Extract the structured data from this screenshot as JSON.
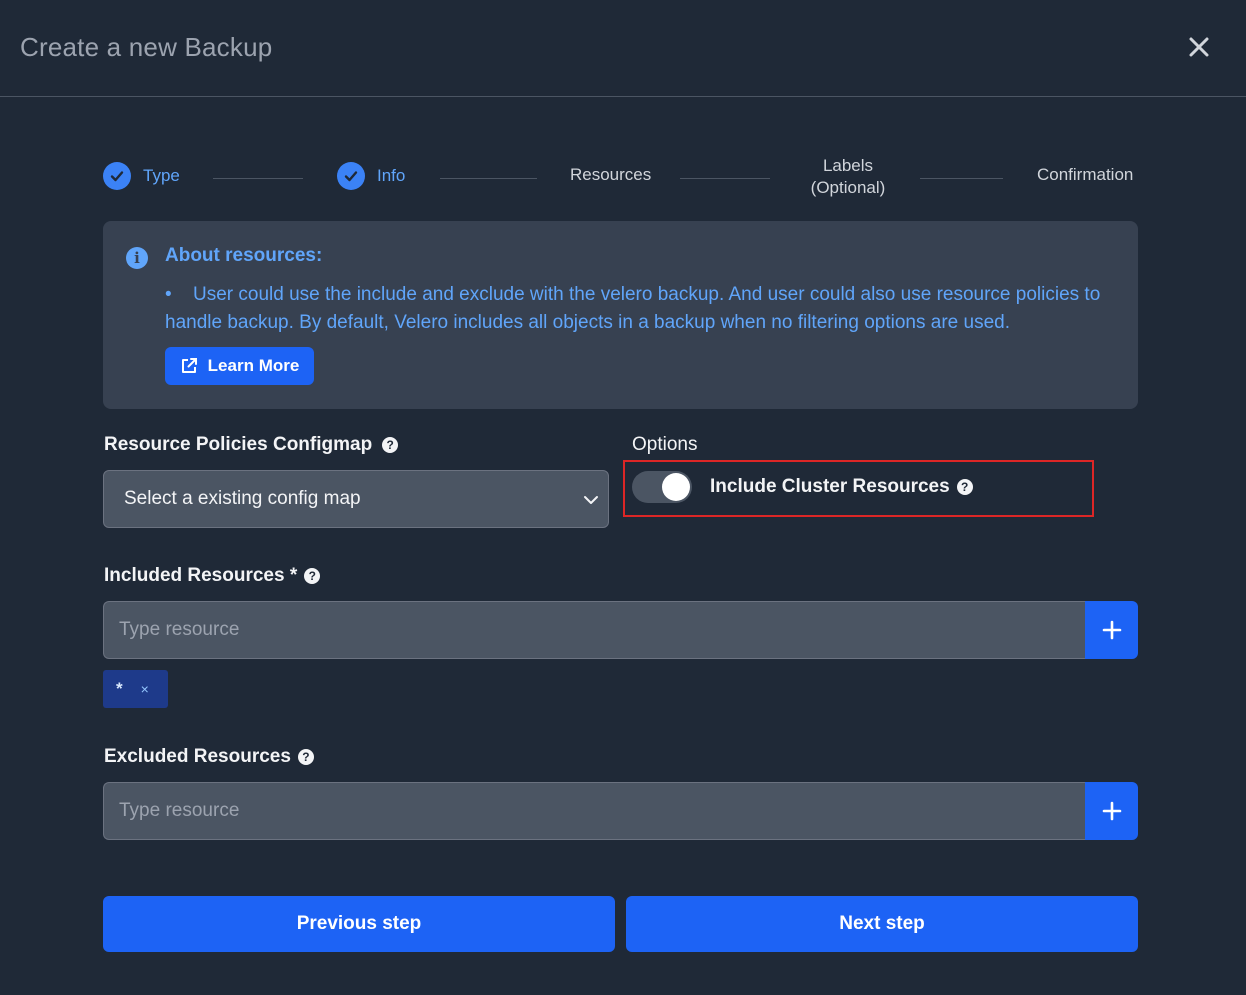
{
  "header": {
    "title": "Create a new Backup"
  },
  "stepper": {
    "steps": [
      {
        "label": "Type",
        "done": true
      },
      {
        "label": "Info",
        "done": true
      },
      {
        "label": "Resources",
        "done": false
      },
      {
        "label_line1": "Labels",
        "label_line2": "(Optional)",
        "done": false
      },
      {
        "label": "Confirmation",
        "done": false
      }
    ]
  },
  "info": {
    "heading": "About resources:",
    "text": "User could use the include and exclude with the velero backup. And user could also use resource policies to handle backup. By default, Velero includes all objects in a backup when no filtering options are used.",
    "learn_more_label": "Learn More"
  },
  "form": {
    "policies_label": "Resource Policies Configmap",
    "policies_select_value": "Select a existing config map",
    "options_label": "Options",
    "include_cluster_label": "Include Cluster Resources",
    "include_cluster_enabled": true,
    "included_label": "Included Resources *",
    "included_placeholder": "Type resource",
    "included_tags": [
      "*"
    ],
    "tag_remove_glyph": "×",
    "excluded_label": "Excluded Resources",
    "excluded_placeholder": "Type resource"
  },
  "footer": {
    "previous_label": "Previous step",
    "next_label": "Next step"
  },
  "colors": {
    "background": "#1f2937",
    "accent": "#1d63f5",
    "info_text": "#60a5fa",
    "highlight": "#dc2626"
  }
}
